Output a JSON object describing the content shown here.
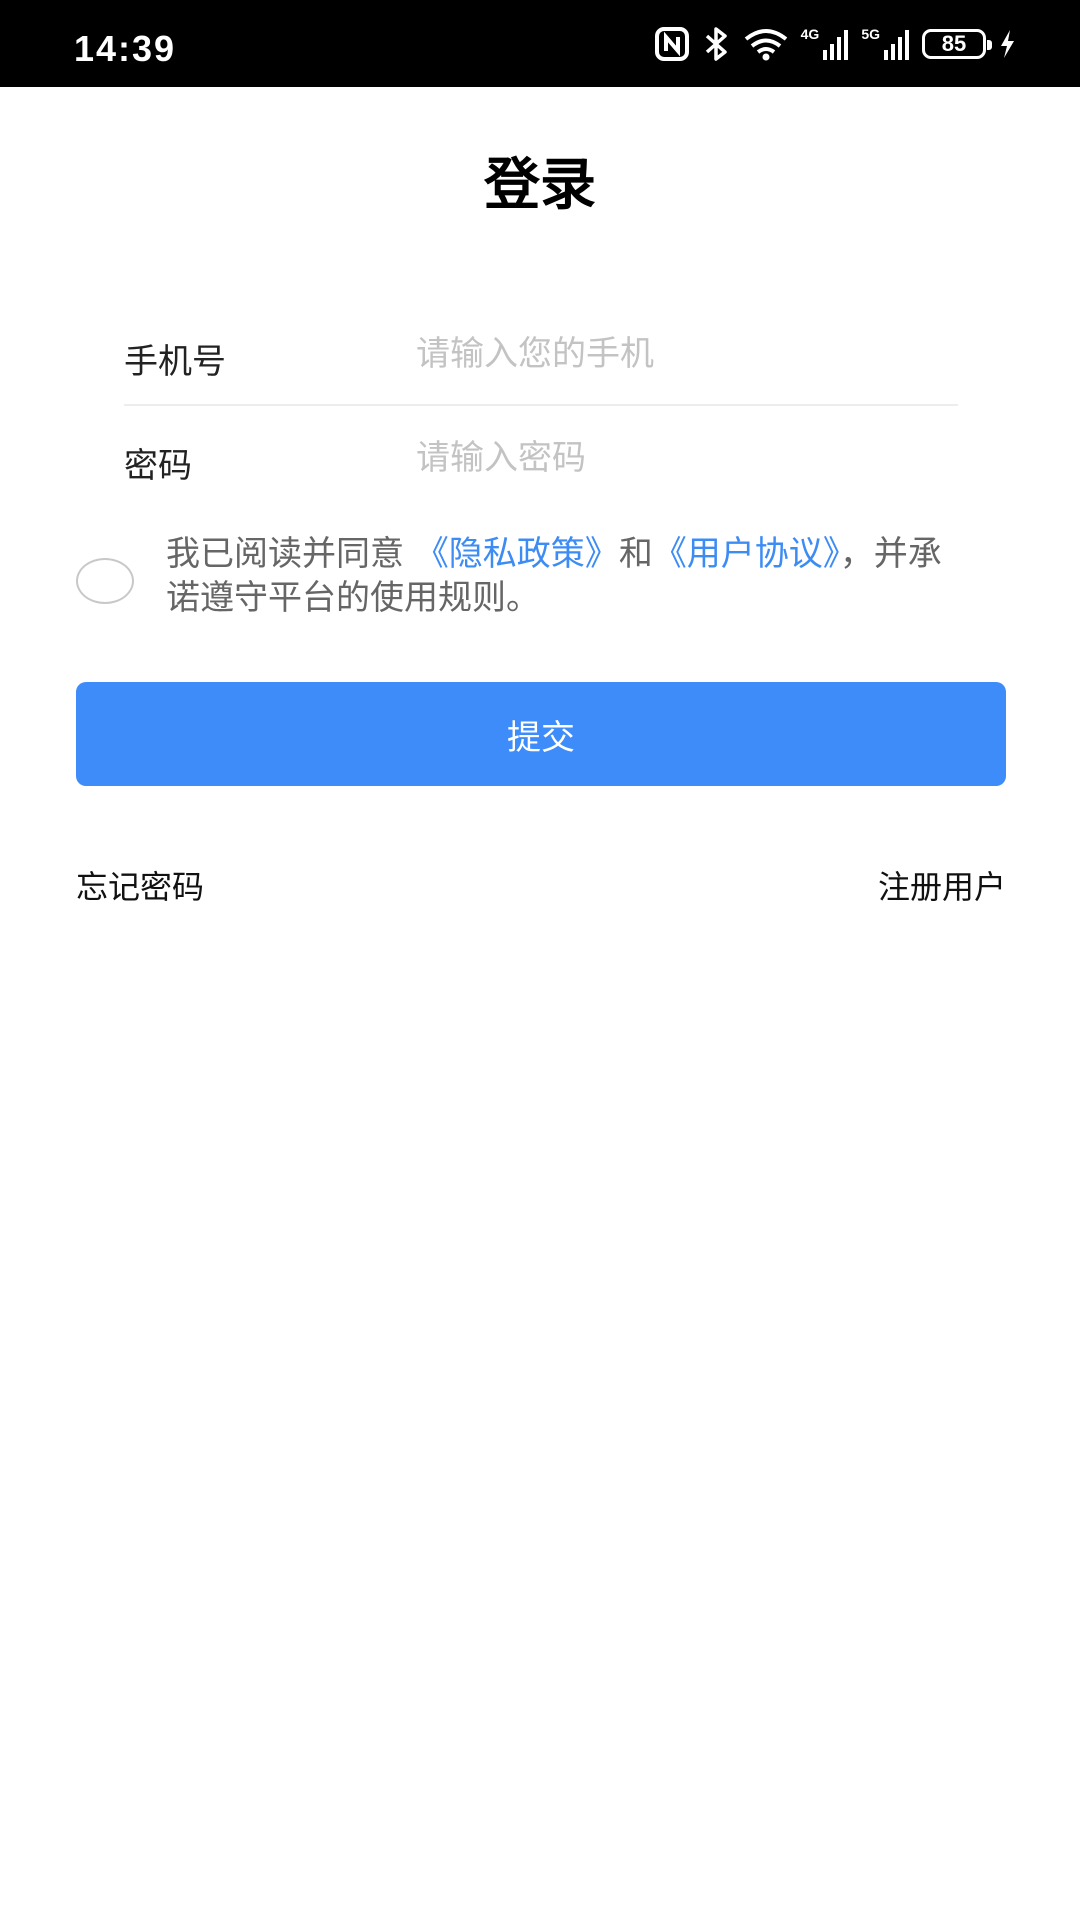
{
  "status_bar": {
    "time": "14:39",
    "icons": [
      "nfc-icon",
      "bluetooth-icon",
      "wifi-icon",
      "signal-4g-icon",
      "signal-5g-icon",
      "battery-icon",
      "charging-icon"
    ],
    "net1": "4G",
    "net2": "5G",
    "battery": "85"
  },
  "page": {
    "title": "登录"
  },
  "form": {
    "phone": {
      "label": "手机号",
      "placeholder": "请输入您的手机",
      "value": ""
    },
    "password": {
      "label": "密码",
      "placeholder": "请输入密码",
      "value": ""
    }
  },
  "agreement": {
    "checked": false,
    "prefix": "我已阅读并同意 ",
    "privacy_link": "《隐私政策》",
    "and": "和",
    "terms_link": "《用户协议》",
    "suffix": "，并承诺遵守平台的使用规则。"
  },
  "actions": {
    "submit": "提交",
    "forgot_password": "忘记密码",
    "register": "注册用户"
  },
  "colors": {
    "primary": "#3d8cf9",
    "link": "#3d8cf4",
    "status_bar": "#000000"
  }
}
